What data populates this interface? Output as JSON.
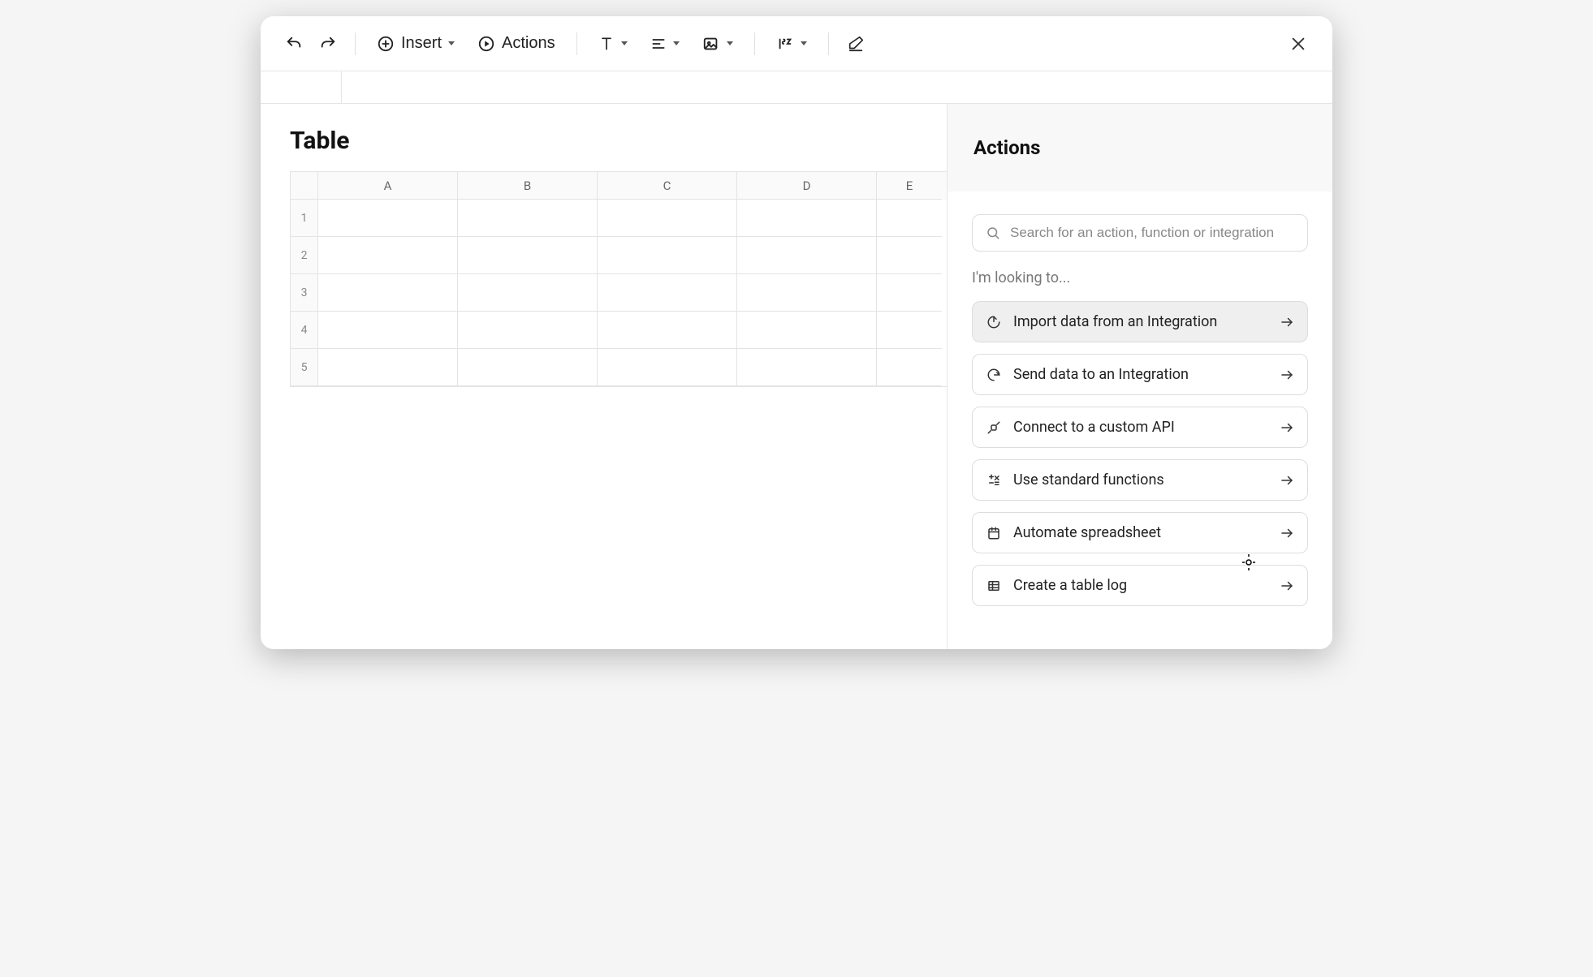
{
  "toolbar": {
    "insert_label": "Insert",
    "actions_label": "Actions"
  },
  "sheet": {
    "title": "Table",
    "columns": [
      "A",
      "B",
      "C",
      "D",
      "E"
    ],
    "rows": [
      "1",
      "2",
      "3",
      "4",
      "5"
    ]
  },
  "panel": {
    "title": "Actions",
    "search_placeholder": "Search for an action, function or integration",
    "looking_label": "I'm looking to...",
    "actions": [
      {
        "label": "Import data from an Integration",
        "icon": "import"
      },
      {
        "label": "Send data to an Integration",
        "icon": "export"
      },
      {
        "label": "Connect to a custom API",
        "icon": "plug"
      },
      {
        "label": "Use standard functions",
        "icon": "fx"
      },
      {
        "label": "Automate spreadsheet",
        "icon": "calendar"
      },
      {
        "label": "Create a table log",
        "icon": "table"
      }
    ]
  }
}
